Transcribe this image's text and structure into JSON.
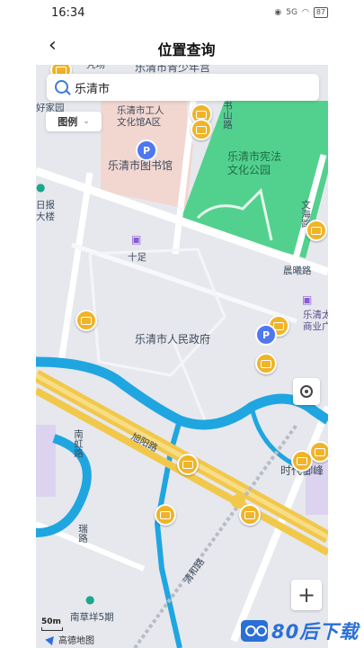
{
  "status": {
    "time": "16:34",
    "battery": "87",
    "network": "5G"
  },
  "nav": {
    "title": "位置查询",
    "back": "‹"
  },
  "search": {
    "value": "乐清市"
  },
  "legend": {
    "label": "图例"
  },
  "map": {
    "labels": {
      "top_partial": "乐清市青少年宫",
      "top_left_partial": "凭场",
      "cultural_hall": "乐清市工人\n文化馆A区",
      "library": "乐清市图书馆",
      "park": "乐清市宪法\n文化公园",
      "shushan_road": "书山路",
      "wenhua_road": "文海路",
      "left_partial1": "好家园",
      "left_partial2": "日报\n大楼",
      "shizu": "十足",
      "chenxi_road": "晨曦路",
      "taigu": "乐清太古\n商业广场",
      "government": "乐清市人民政府",
      "xuyang_road": "旭阳路",
      "nanhong_road": "南虹路",
      "rui_road": "瑞路",
      "jiaxiang_road": "清和路",
      "yinghu": "时代御峰",
      "nancaoyang": "南草垟5期"
    }
  },
  "controls": {
    "zoom_in": "+",
    "scale": "50m",
    "map_logo": "高德地图"
  },
  "watermark": {
    "text": "80后下载"
  }
}
